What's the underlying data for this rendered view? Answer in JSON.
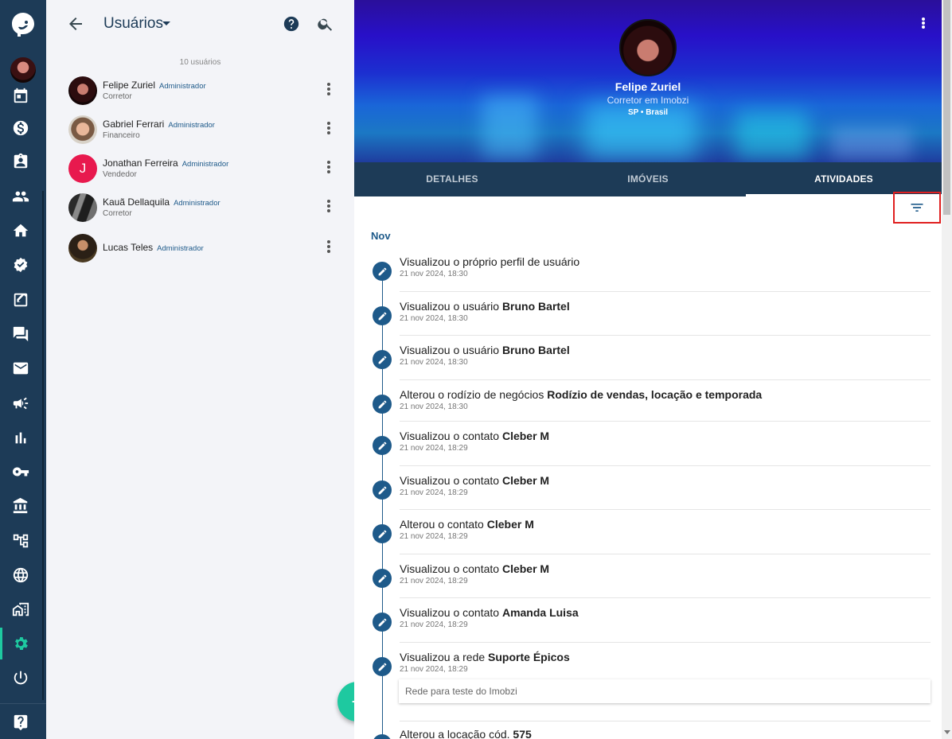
{
  "list": {
    "title": "Usuários",
    "count_text": "10 usuários",
    "users": [
      {
        "name": "Felipe Zuriel",
        "badge": "Administrador",
        "role": "Corretor"
      },
      {
        "name": "Gabriel Ferrari",
        "badge": "Administrador",
        "role": "Financeiro"
      },
      {
        "name": "Jonathan Ferreira",
        "badge": "Administrador",
        "role": "Vendedor",
        "initial": "J"
      },
      {
        "name": "Kauã Dellaquila",
        "badge": "Administrador",
        "role": "Corretor"
      },
      {
        "name": "Lucas Teles",
        "badge": "Administrador",
        "role": ""
      }
    ],
    "fab_label": "+"
  },
  "profile": {
    "name": "Felipe Zuriel",
    "subtitle": "Corretor em Imobzi",
    "location": "SP • Brasil"
  },
  "tabs": [
    "DETALHES",
    "IMÓVEIS",
    "ATIVIDADES"
  ],
  "active_tab": "ATIVIDADES",
  "activities": {
    "month": "Nov",
    "items": [
      {
        "text": "Visualizou o próprio perfil de usuário",
        "bold": "",
        "date": "21 nov 2024, 18:30"
      },
      {
        "text": "Visualizou o usuário ",
        "bold": "Bruno Bartel",
        "date": "21 nov 2024, 18:30"
      },
      {
        "text": "Visualizou o usuário ",
        "bold": "Bruno Bartel",
        "date": "21 nov 2024, 18:30"
      },
      {
        "text": "Alterou o rodízio de negócios ",
        "bold": "Rodízio de vendas, locação e temporada",
        "date": "21 nov 2024, 18:30"
      },
      {
        "text": "Visualizou o contato ",
        "bold": "Cleber M",
        "date": "21 nov 2024, 18:29"
      },
      {
        "text": "Visualizou o contato ",
        "bold": "Cleber M",
        "date": "21 nov 2024, 18:29"
      },
      {
        "text": "Alterou o contato ",
        "bold": "Cleber M",
        "date": "21 nov 2024, 18:29"
      },
      {
        "text": "Visualizou o contato ",
        "bold": "Cleber M",
        "date": "21 nov 2024, 18:29"
      },
      {
        "text": "Visualizou o contato ",
        "bold": "Amanda Luisa",
        "date": "21 nov 2024, 18:29"
      },
      {
        "text": "Visualizou a rede ",
        "bold": "Suporte Épicos",
        "date": "21 nov 2024, 18:29",
        "note": "Rede para teste do Imobzi"
      },
      {
        "text": "Alterou a locação cód. ",
        "bold": "575",
        "date": ""
      }
    ]
  },
  "colors": {
    "rail": "#1d3b57",
    "accent": "#1ec9a0",
    "link": "#1e5a8a",
    "highlight": "#e02020"
  },
  "icons": {
    "rail": [
      "logo-icon",
      "calendar-icon",
      "dollar-icon",
      "clipboard-icon",
      "people-icon",
      "home-icon",
      "check-circle-icon",
      "edit-note-icon",
      "chat-icon",
      "mail-icon",
      "megaphone-icon",
      "bar-chart-icon",
      "key-icon",
      "bank-icon",
      "org-tree-icon",
      "globe-icon",
      "buildings-icon",
      "settings-icon",
      "power-icon",
      "help-icon"
    ]
  }
}
